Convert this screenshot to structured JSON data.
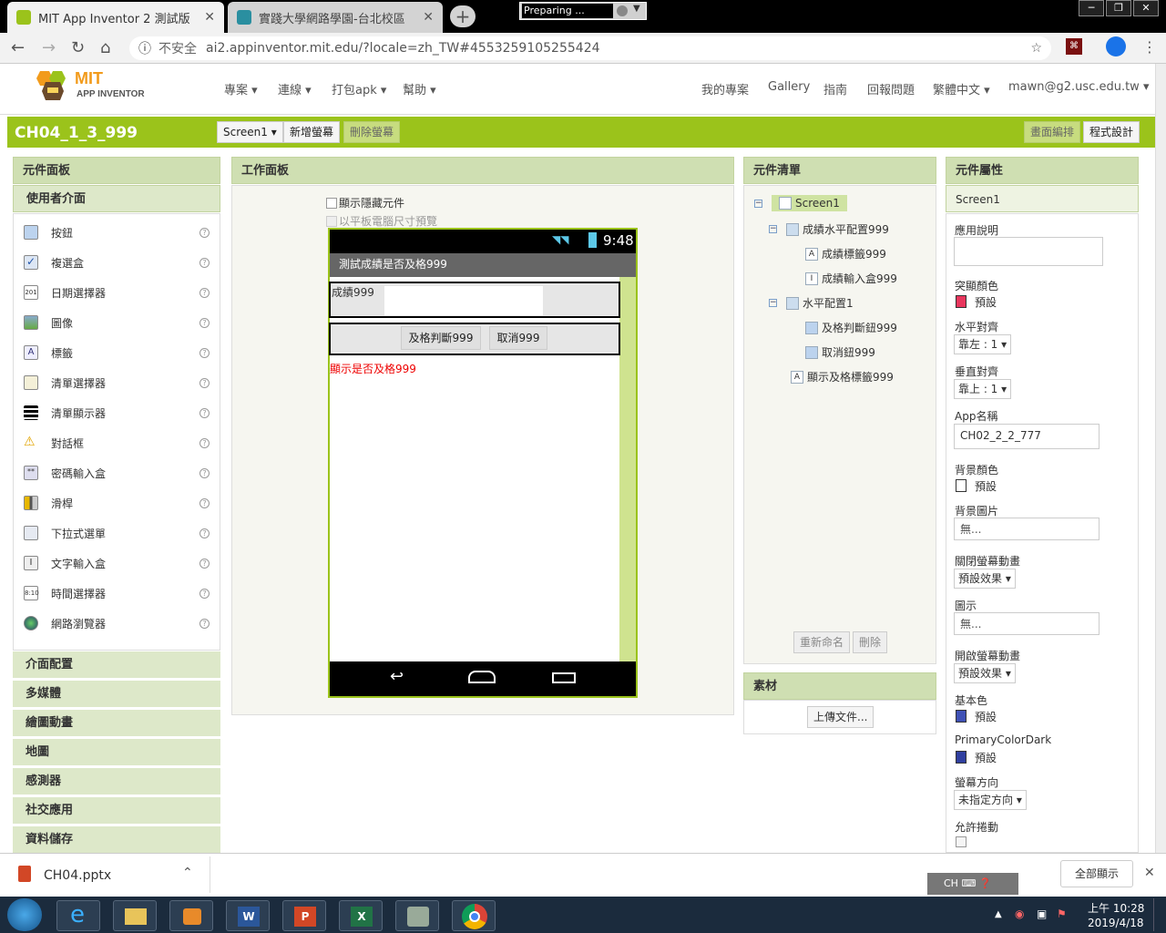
{
  "browser": {
    "tabs": [
      {
        "title": "MIT App Inventor 2 測試版"
      },
      {
        "title": "實踐大學網路學園-台北校區"
      }
    ],
    "preparing": "Preparing ...",
    "address": {
      "insecure_label": "不安全",
      "url": "ai2.appinventor.mit.edu/?locale=zh_TW#4553259105255424"
    }
  },
  "ai_header": {
    "logo_mit": "MIT",
    "logo_sub": "APP INVENTOR",
    "left_menu": [
      "專案",
      "連線",
      "打包apk",
      "幫助"
    ],
    "right_menu": [
      "我的專案",
      "Gallery",
      "指南",
      "回報問題",
      "繁體中文",
      "mawn@g2.usc.edu.tw"
    ]
  },
  "toolbar": {
    "project_name": "CH04_1_3_999",
    "screen_select": "Screen1",
    "add_screen": "新增螢幕",
    "remove_screen": "刪除螢幕",
    "designer": "畫面編排",
    "blocks": "程式設計"
  },
  "palette": {
    "title": "元件面板",
    "category": "使用者介面",
    "items": [
      "按鈕",
      "複選盒",
      "日期選擇器",
      "圖像",
      "標籤",
      "清單選擇器",
      "清單顯示器",
      "對話框",
      "密碼輸入盒",
      "滑桿",
      "下拉式選單",
      "文字輸入盒",
      "時間選擇器",
      "網路瀏覽器"
    ],
    "categories": [
      "介面配置",
      "多媒體",
      "繪圖動畫",
      "地圖",
      "感測器",
      "社交應用",
      "資料儲存"
    ]
  },
  "viewer": {
    "title": "工作面板",
    "show_hidden": "顯示隱藏元件",
    "tablet_preview": "以平板電腦尺寸預覽",
    "time": "9:48",
    "app_title": "測試成績是否及格999",
    "score_label": "成績999",
    "pass_button": "及格判斷999",
    "cancel_button": "取消999",
    "result_label": "顯示是否及格999"
  },
  "components": {
    "title": "元件清單",
    "tree": [
      "Screen1",
      "成績水平配置999",
      "成績標籤999",
      "成績輸入盒999",
      "水平配置1",
      "及格判斷鈕999",
      "取消鈕999",
      "顯示及格標籤999"
    ],
    "rename": "重新命名",
    "delete": "刪除",
    "media_title": "素材",
    "upload": "上傳文件..."
  },
  "properties": {
    "title": "元件屬性",
    "component": "Screen1",
    "about_label": "應用說明",
    "accent_label": "突顯顏色",
    "accent_value": "預設",
    "halign_label": "水平對齊",
    "halign_value": "靠左 : 1",
    "valign_label": "垂直對齊",
    "valign_value": "靠上 : 1",
    "appname_label": "App名稱",
    "appname_value": "CH02_2_2_777",
    "bgcolor_label": "背景顏色",
    "bgcolor_value": "預設",
    "bgimage_label": "背景圖片",
    "bgimage_value": "無...",
    "close_anim_label": "關閉螢幕動畫",
    "close_anim_value": "預設效果",
    "icon_label": "圖示",
    "icon_value": "無...",
    "open_anim_label": "開啟螢幕動畫",
    "open_anim_value": "預設效果",
    "primary_label": "基本色",
    "primary_value": "預設",
    "primary_dark_label": "PrimaryColorDark",
    "primary_dark_value": "預設",
    "orientation_label": "螢幕方向",
    "orientation_value": "未指定方向",
    "scroll_label": "允許捲動"
  },
  "colors": {
    "accent": "#e8365d",
    "primary": "#3f51b5",
    "primary_dark": "#303f9f",
    "ai_green": "#9bc31b"
  },
  "downloads": {
    "file": "CH04.pptx",
    "show_all": "全部顯示"
  },
  "taskbar": {
    "ime": "CH",
    "time": "上午 10:28",
    "date": "2019/4/18"
  }
}
